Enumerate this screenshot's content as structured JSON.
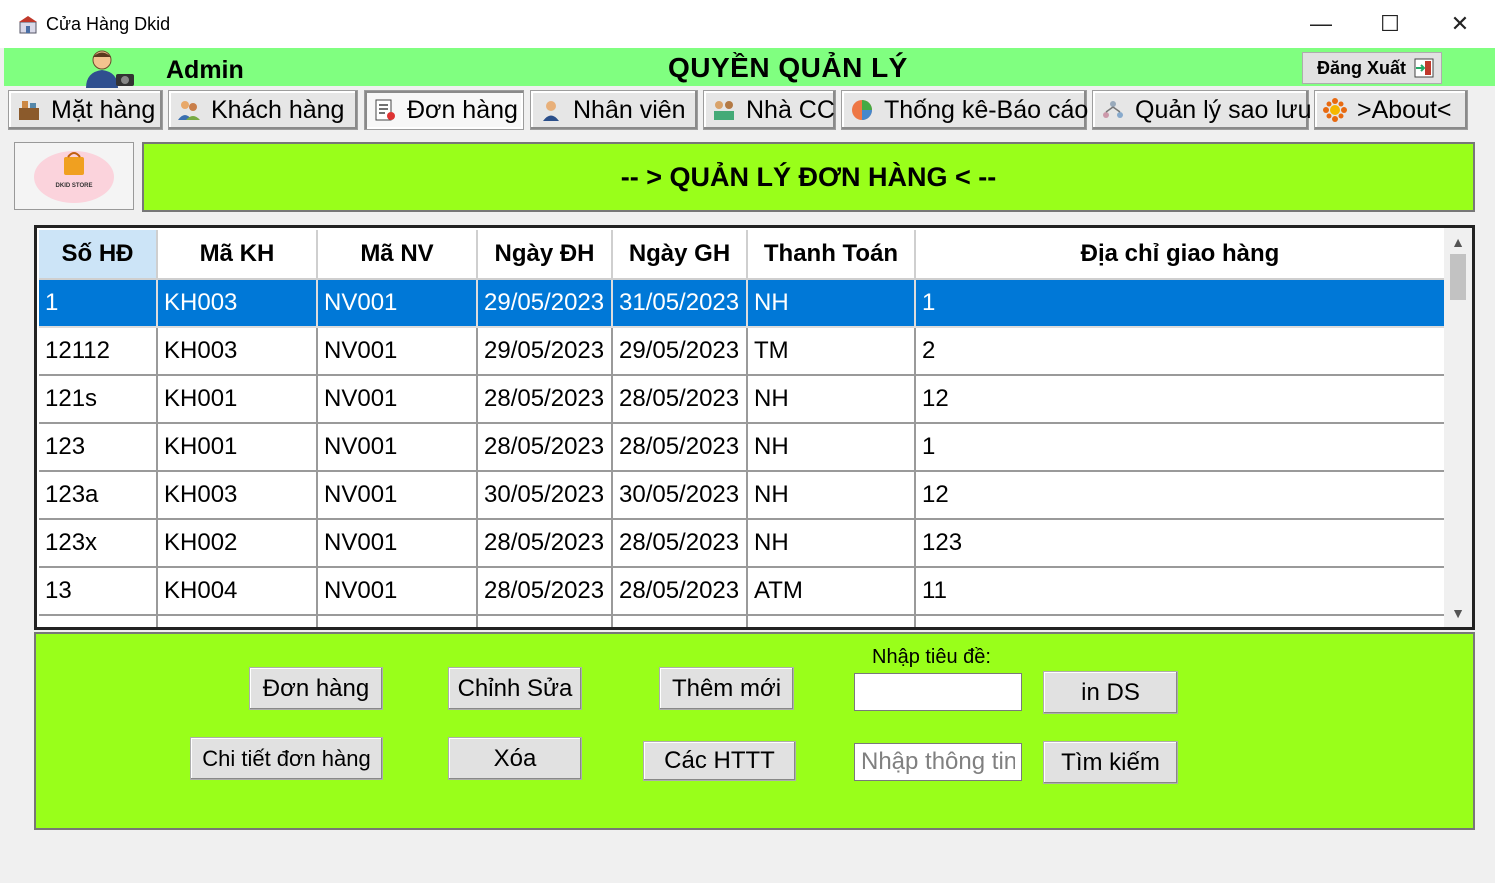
{
  "window": {
    "title": "Cửa Hàng Dkid",
    "minimize": "—",
    "maximize": "☐",
    "close": "✕"
  },
  "header": {
    "user": "Admin",
    "title": "QUYỀN QUẢN LÝ",
    "logout": "Đăng Xuất",
    "bg_color": "#80ff80"
  },
  "tabs": [
    {
      "label": "Mặt hàng",
      "icon": "products-icon"
    },
    {
      "label": "Khách hàng",
      "icon": "customers-icon"
    },
    {
      "label": "Đơn hàng",
      "icon": "orders-icon",
      "active": true
    },
    {
      "label": "Nhân viên",
      "icon": "employee-icon"
    },
    {
      "label": "Nhà CC",
      "icon": "supplier-icon"
    },
    {
      "label": "Thống kê-Báo cáo",
      "icon": "report-icon"
    },
    {
      "label": "Quản lý sao lưu",
      "icon": "backup-icon"
    },
    {
      "label": ">About<",
      "icon": "about-icon"
    }
  ],
  "logo_text": "DKID STORE",
  "section_title": "-- > QUẢN LÝ ĐƠN HÀNG < --",
  "accent_color": "#99ff1a",
  "grid": {
    "columns": [
      "Số HĐ",
      "Mã KH",
      "Mã NV",
      "Ngày ĐH",
      "Ngày GH",
      "Thanh Toán",
      "Địa chỉ giao hàng"
    ],
    "rows": [
      [
        "1",
        "KH003",
        "NV001",
        "29/05/2023",
        "31/05/2023",
        "NH",
        "1"
      ],
      [
        "12112",
        "KH003",
        "NV001",
        "29/05/2023",
        "29/05/2023",
        "TM",
        "2"
      ],
      [
        "121s",
        "KH001",
        "NV001",
        "28/05/2023",
        "28/05/2023",
        "NH",
        "12"
      ],
      [
        "123",
        "KH001",
        "NV001",
        "28/05/2023",
        "28/05/2023",
        "NH",
        "1"
      ],
      [
        "123a",
        "KH003",
        "NV001",
        "30/05/2023",
        "30/05/2023",
        "NH",
        "12"
      ],
      [
        "123x",
        "KH002",
        "NV001",
        "28/05/2023",
        "28/05/2023",
        "NH",
        "123"
      ],
      [
        "13",
        "KH004",
        "NV001",
        "28/05/2023",
        "28/05/2023",
        "ATM",
        "11"
      ]
    ],
    "selected_row": 0,
    "selection_color": "#0078d7"
  },
  "actions": {
    "orders": "Đơn hàng",
    "edit": "Chỉnh Sửa",
    "add_new": "Thêm mới",
    "title_label": "Nhập tiêu đề:",
    "title_value": "",
    "print_list": "in DS",
    "order_details": "Chi tiết đơn hàng",
    "delete": "Xóa",
    "payment_methods": "Các HTTT",
    "search_placeholder": "Nhập thông tin",
    "search": "Tìm kiếm"
  }
}
